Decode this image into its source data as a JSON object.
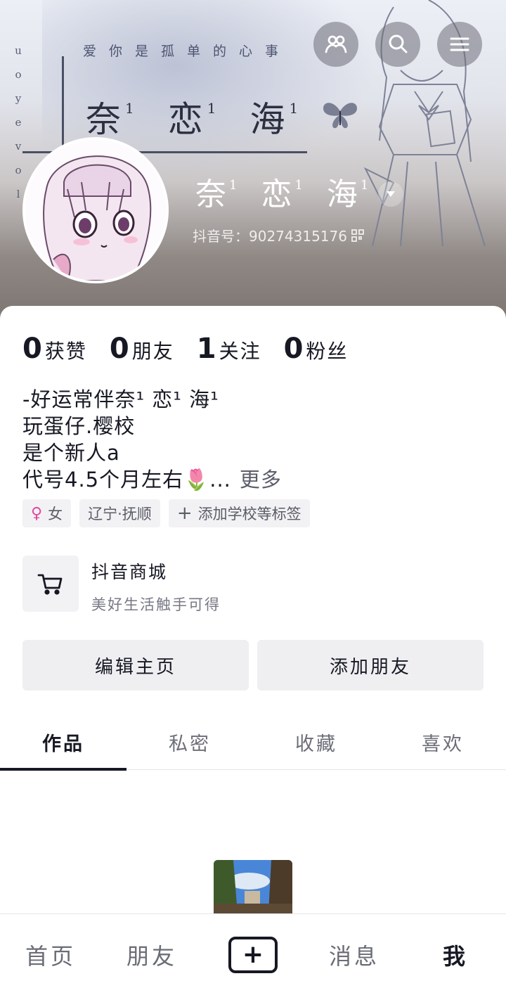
{
  "cover": {
    "vertical_text": [
      "u",
      "o",
      "y",
      "e",
      "v",
      "o",
      "l"
    ],
    "slogan": "爱你是孤单的心事",
    "big_title": [
      {
        "char": "奈",
        "sup": "1"
      },
      {
        "char": "恋",
        "sup": "1"
      },
      {
        "char": "海",
        "sup": "1"
      }
    ]
  },
  "top_buttons": {
    "friends_icon": "people-icon",
    "search_icon": "search-icon",
    "menu_icon": "menu-icon"
  },
  "profile": {
    "nickname": [
      {
        "char": "奈",
        "sup": "1"
      },
      {
        "char": "恋",
        "sup": "1"
      },
      {
        "char": "海",
        "sup": "1"
      }
    ],
    "douyin_id": "抖音号：90274315176"
  },
  "stats": [
    {
      "num": "0",
      "label": "获赞"
    },
    {
      "num": "0",
      "label": "朋友"
    },
    {
      "num": "1",
      "label": "关注"
    },
    {
      "num": "0",
      "label": "粉丝"
    }
  ],
  "bio": {
    "lines": [
      "-好运常伴奈¹ 恋¹ 海¹",
      "玩蛋仔.樱校",
      "是个新人a",
      "代号4.5个月左右🌷..."
    ],
    "more": "更多"
  },
  "tags": {
    "gender": "女",
    "gender_icon": "female-icon",
    "location": "辽宁·抚顺",
    "add_tag": "添加学校等标签"
  },
  "shop": {
    "title": "抖音商城",
    "subtitle": "美好生活触手可得"
  },
  "buttons": {
    "edit_profile": "编辑主页",
    "add_friend": "添加朋友"
  },
  "tabs": [
    "作品",
    "私密",
    "收藏",
    "喜欢"
  ],
  "active_tab": 0,
  "bottom_nav": {
    "home": "首页",
    "friends": "朋友",
    "create": "+",
    "messages": "消息",
    "me": "我"
  },
  "colors": {
    "text_primary": "#161823",
    "text_secondary": "#6c6e78",
    "chip_bg": "#f2f2f4",
    "gender_pink": "#e0479e"
  }
}
